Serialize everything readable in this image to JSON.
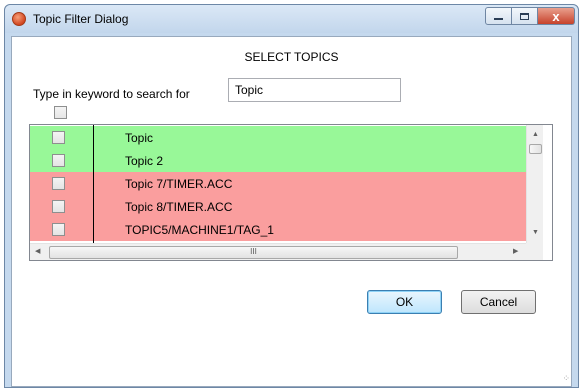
{
  "window": {
    "title": "Topic Filter Dialog",
    "close_glyph": "x"
  },
  "dialog": {
    "heading": "SELECT TOPICS",
    "search_label": "Type in keyword to search for",
    "search_value": "Topic"
  },
  "topics": [
    {
      "name": "Topic",
      "status": "matched",
      "color": "#98f898"
    },
    {
      "name": "Topic 2",
      "status": "matched",
      "color": "#98f898"
    },
    {
      "name": "Topic 7/TIMER.ACC",
      "status": "unmatched",
      "color": "#fa9e9e"
    },
    {
      "name": "Topic 8/TIMER.ACC",
      "status": "unmatched",
      "color": "#fa9e9e"
    },
    {
      "name": "TOPIC5/MACHINE1/TAG_1",
      "status": "unmatched",
      "color": "#fa9e9e"
    }
  ],
  "scrollbar": {
    "thumb_grip": "III"
  },
  "buttons": {
    "ok_label": "OK",
    "cancel_label": "Cancel"
  },
  "icons": {
    "app": "app-logo-icon",
    "minimize": "minimize-icon",
    "maximize": "maximize-icon",
    "close": "close-icon",
    "up": "scroll-up-arrow-icon",
    "down": "scroll-down-arrow-icon",
    "left": "scroll-left-arrow-icon",
    "right": "scroll-right-arrow-icon",
    "grip": "resize-grip-icon"
  }
}
